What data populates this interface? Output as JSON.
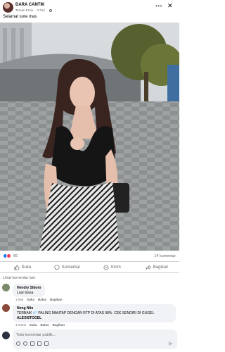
{
  "post": {
    "author": "DARA CANTIK",
    "subtitle": "Teman Ernie",
    "time": "2 hari",
    "caption": "Selamat sore mas"
  },
  "reactions": {
    "count": "66",
    "comments": "14 komentar"
  },
  "actions": {
    "like": "Suka",
    "comment": "Komentar",
    "send": "Kirim",
    "share": "Bagikan"
  },
  "comments_header": "Lihat komentar lain",
  "comments": [
    {
      "name": "Hendry Siboro",
      "text": "Luar biasa",
      "time": "1 hari",
      "like": "Suka",
      "reply": "Balas",
      "share": "Bagikan"
    },
    {
      "name": "Neng Nlin",
      "text": "TERBAIK 💎 PALING MANTAP DENGAN RTP DI ATAS 98%. CEK SENDIRI DI GUGEL",
      "highlight": "ALEXISTOGEL",
      "time": "1 menit",
      "like": "Suka",
      "reply": "Balas",
      "share": "Bagikan"
    }
  ],
  "composer": {
    "placeholder": "Tulis komentar publik..."
  },
  "colors": {
    "like_blue": "#1877f2",
    "love_red": "#f33e58",
    "muted_text": "#65676b",
    "bubble_bg": "#f0f2f5"
  },
  "icons": [
    "more-icon",
    "close-icon",
    "globe-icon",
    "like-icon",
    "comment-icon",
    "messenger-icon",
    "share-icon",
    "send-icon"
  ]
}
